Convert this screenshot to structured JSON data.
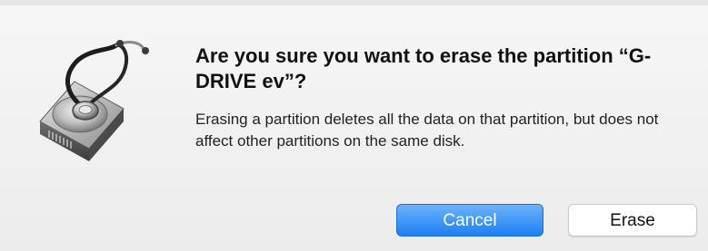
{
  "dialog": {
    "title": "Are you sure you want to erase the partition “G-DRIVE ev”?",
    "message": "Erasing a partition deletes all the data on that partition, but does not affect other partitions on the same disk.",
    "icon": "disk-utility-icon",
    "buttons": {
      "cancel_label": "Cancel",
      "erase_label": "Erase"
    }
  },
  "colors": {
    "accent": "#1d7ff4",
    "dialog_background": "#ececec"
  }
}
